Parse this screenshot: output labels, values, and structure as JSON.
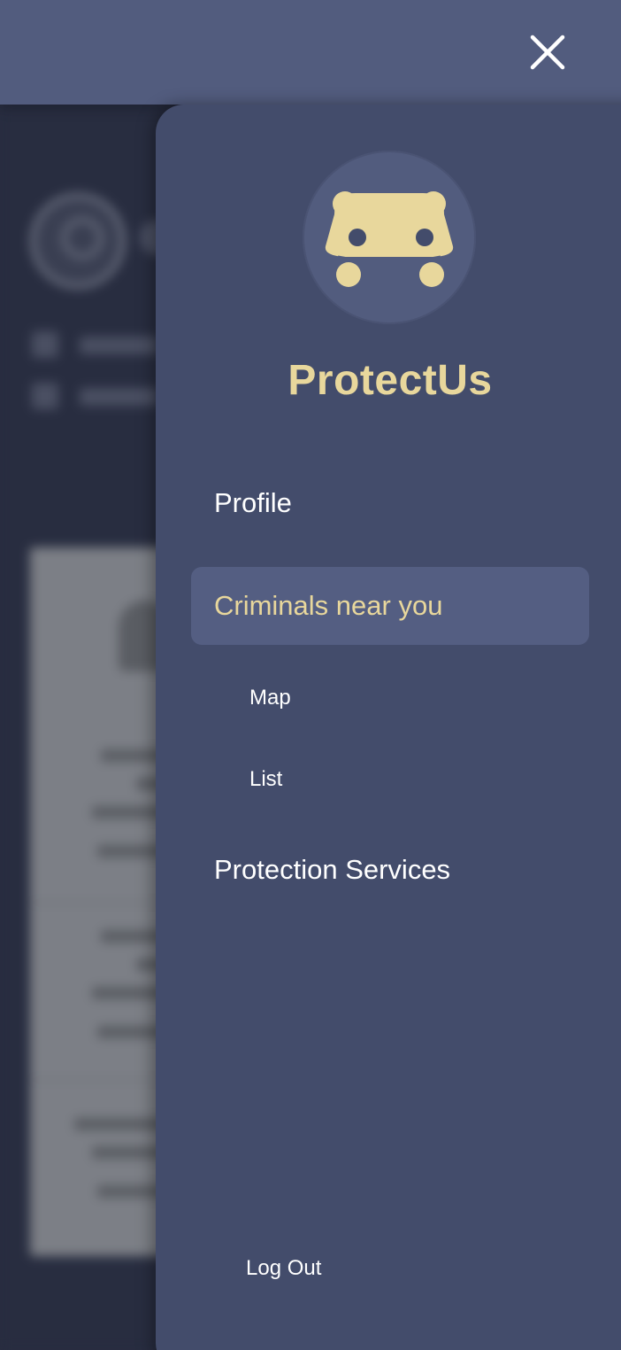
{
  "app": {
    "brand": "ProtectUs"
  },
  "header": {
    "close_icon": "close-icon"
  },
  "drawer": {
    "logo_icon": "hippo-logo-icon",
    "nav": {
      "profile": "Profile",
      "criminals_near_you": "Criminals near you",
      "map": "Map",
      "list": "List",
      "protection_services": "Protection Services"
    },
    "logout": "Log Out"
  },
  "colors": {
    "header": "#525c7e",
    "drawer": "#434c6b",
    "active_item": "#545e82",
    "accent": "#e8d79c",
    "text": "#ffffff"
  }
}
